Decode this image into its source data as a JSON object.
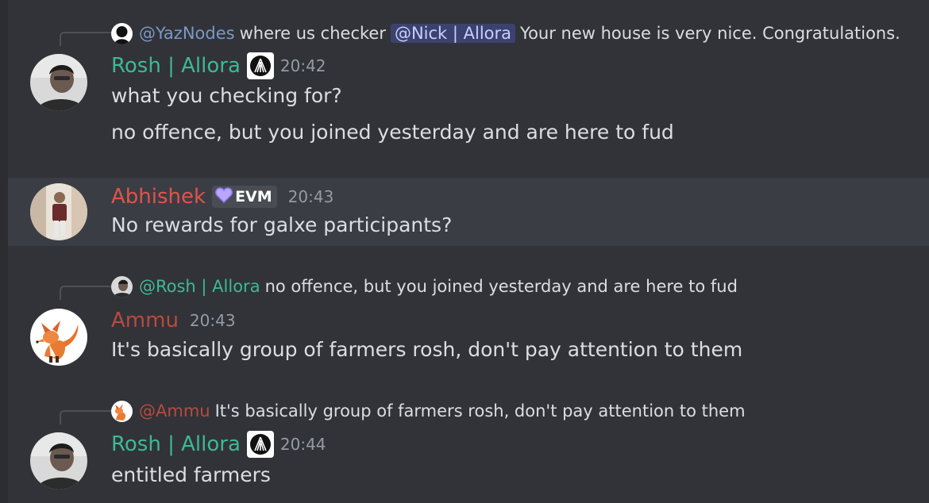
{
  "colors": {
    "background": "#313338",
    "hover_background": "#3b3d44",
    "text": "#dbdee1",
    "muted": "#949ba4",
    "allora_green": "#3fb991",
    "abhishek_red": "#e0534a",
    "ammu_red": "#b84a3f",
    "mention_bg": "#3c4270"
  },
  "messages": [
    {
      "reply": {
        "author": "@YazNodes",
        "text_before": "where us checker",
        "mention": "@Nick | Allora",
        "text_after": "Your new house is very nice. Congratulations."
      },
      "author": "Rosh | Allora",
      "role_icon": "allora-logo-icon",
      "time": "20:42",
      "lines": [
        "what you checking for?",
        "no offence, but you joined yesterday and are here to fud"
      ]
    },
    {
      "author": "Abhishek",
      "tag_icon": "purple-heart-icon",
      "tag": "EVM",
      "time": "20:43",
      "lines": [
        "No rewards for galxe participants?"
      ]
    },
    {
      "reply": {
        "author": "@Rosh | Allora",
        "text": "no offence, but you joined yesterday and are here to fud"
      },
      "author": "Ammu",
      "time": "20:43",
      "lines": [
        "It's basically group of farmers rosh, don't pay attention to them"
      ]
    },
    {
      "reply": {
        "author": "@Ammu",
        "text": "It's basically group of farmers rosh, don't pay attention to them"
      },
      "author": "Rosh | Allora",
      "role_icon": "allora-logo-icon",
      "time": "20:44",
      "lines": [
        "entitled farmers"
      ]
    }
  ]
}
